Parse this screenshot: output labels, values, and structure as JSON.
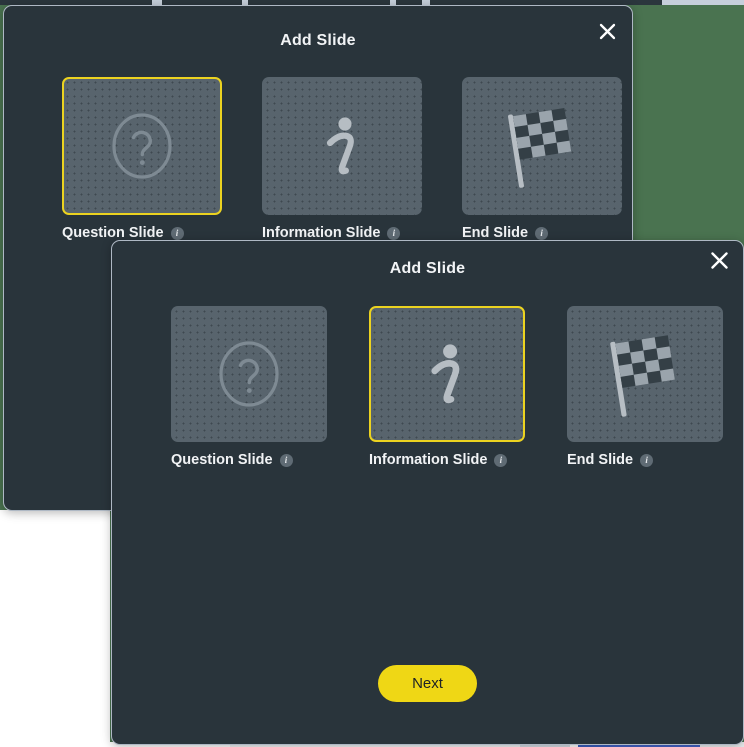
{
  "theme": {
    "desktop_background": "#4a7350",
    "dialog_background": "#29343b",
    "dialog_border": "#aeb8c4",
    "tile_background": "#58646d",
    "selection_accent": "#ecd320",
    "primary_button_background": "#efd715",
    "primary_button_text": "#1d2226",
    "title_text": "#f2f4f6"
  },
  "back_dialog": {
    "title": "Add Slide",
    "close_label": "×",
    "selected_option_index": 0,
    "options": [
      {
        "label": "Question Slide",
        "icon": "question-mark-circle-icon",
        "info_label": "i",
        "selected": true
      },
      {
        "label": "Information Slide",
        "icon": "information-i-icon",
        "info_label": "i",
        "selected": false
      },
      {
        "label": "End Slide",
        "icon": "checkered-flag-icon",
        "info_label": "i",
        "selected": false
      }
    ]
  },
  "front_dialog": {
    "title": "Add Slide",
    "close_label": "×",
    "selected_option_index": 1,
    "options": [
      {
        "label": "Question Slide",
        "icon": "question-mark-circle-icon",
        "info_label": "i",
        "selected": false
      },
      {
        "label": "Information Slide",
        "icon": "information-i-icon",
        "info_label": "i",
        "selected": true
      },
      {
        "label": "End Slide",
        "icon": "checkered-flag-icon",
        "info_label": "i",
        "selected": false
      }
    ],
    "primary_action": "Next"
  }
}
